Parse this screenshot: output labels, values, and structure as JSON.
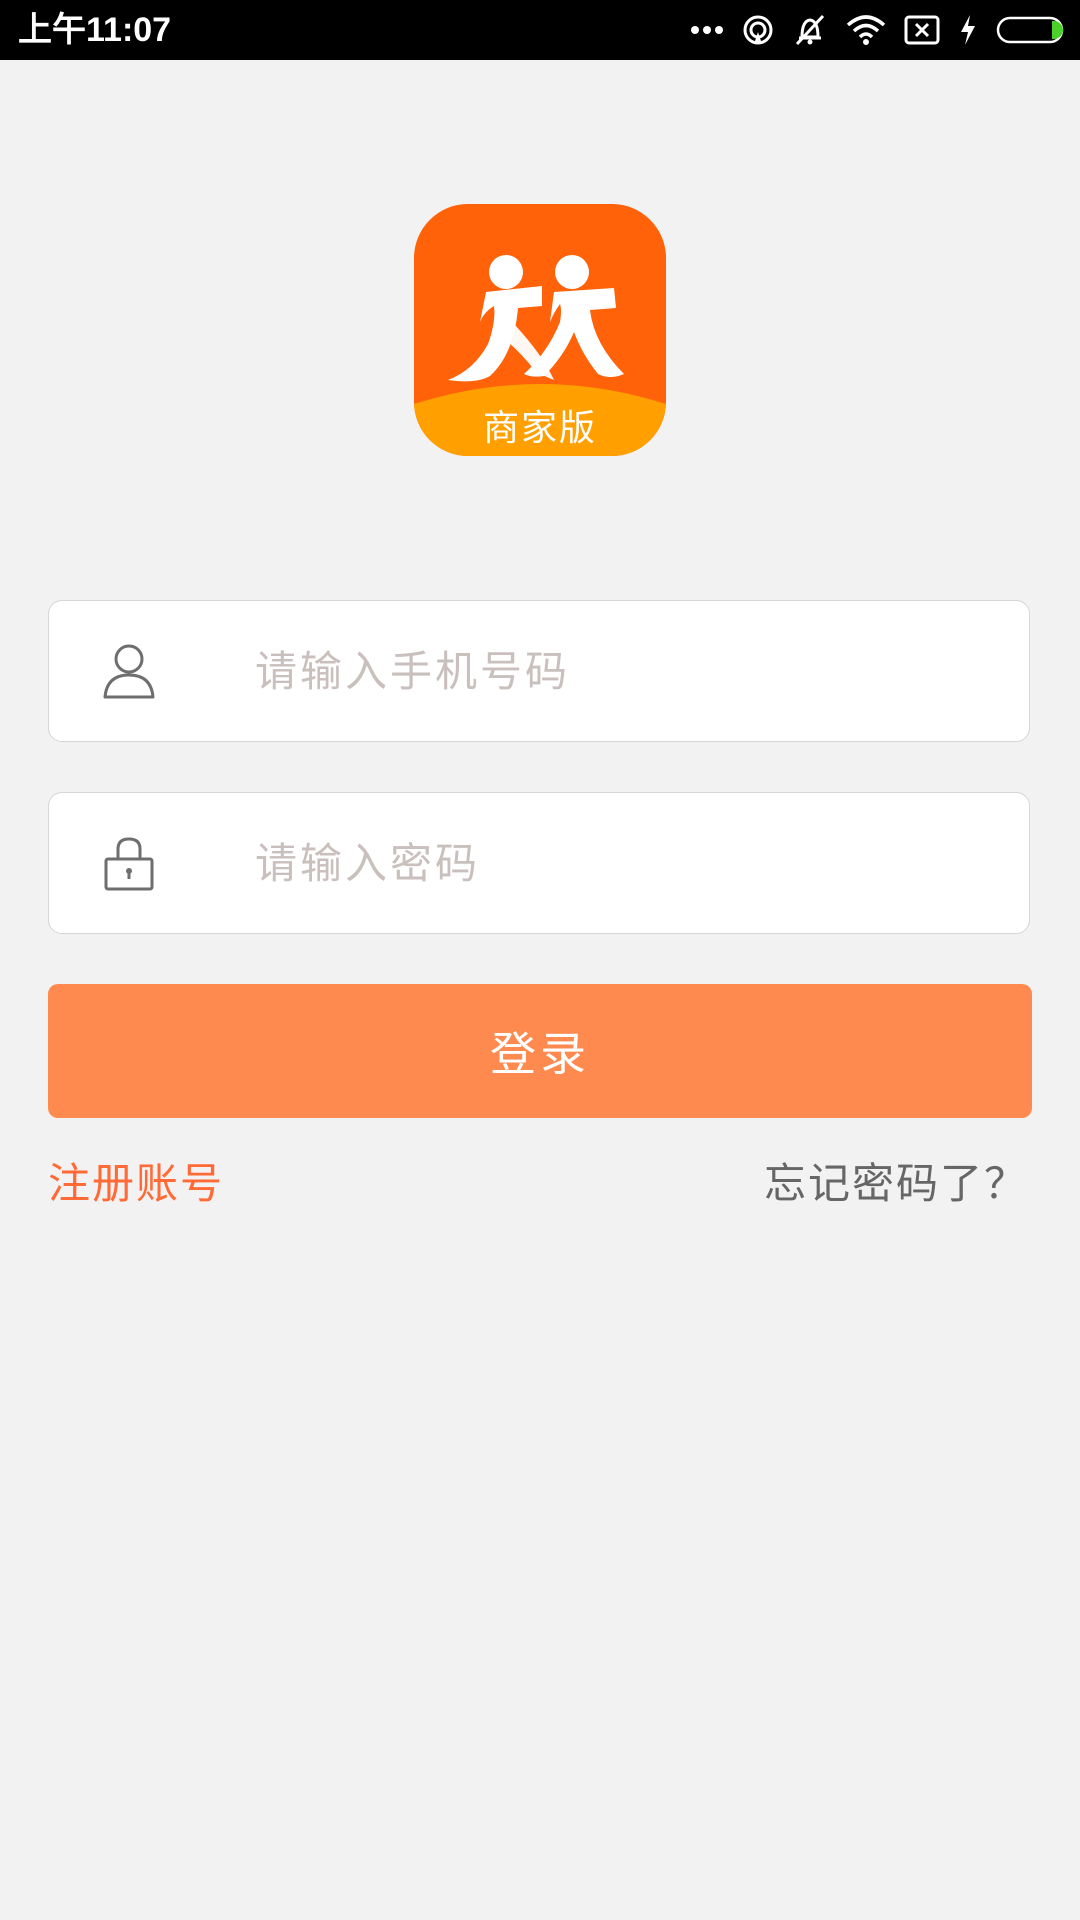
{
  "status_bar": {
    "time": "上午11:07",
    "icons": [
      "more-dots-icon",
      "hotspot-icon",
      "vibrate-icon",
      "wifi-icon",
      "no-sim-icon",
      "charging-icon",
      "battery-icon"
    ],
    "battery_color": "#4cd12a"
  },
  "logo": {
    "caption": "商家版",
    "icon": "two-runners-logo",
    "colors": {
      "background": "#ff6208",
      "band": "#ffa000"
    }
  },
  "phone_field": {
    "icon": "user-icon",
    "placeholder": "请输入手机号码",
    "value": ""
  },
  "password_field": {
    "icon": "lock-icon",
    "placeholder": "请输入密码",
    "value": ""
  },
  "login_button": {
    "label": "登录",
    "color": "#ff8a50"
  },
  "register_link": {
    "label": "注册账号",
    "color": "#ff6a37"
  },
  "forgot_link": {
    "label": "忘记密码了？"
  }
}
